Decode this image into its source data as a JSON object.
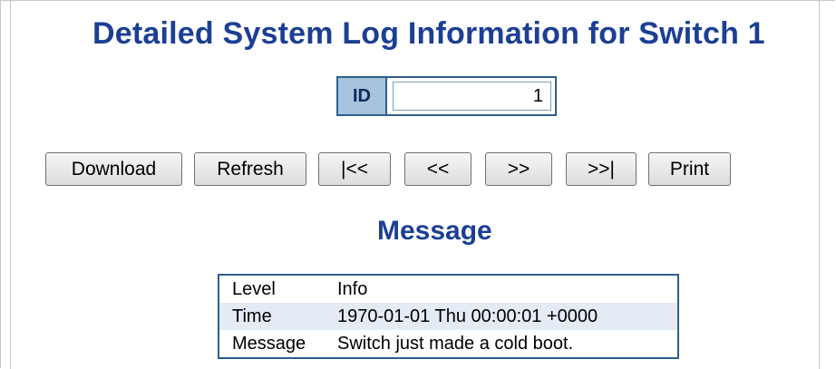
{
  "page": {
    "title": "Detailed System Log Information for Switch 1"
  },
  "id_field": {
    "label": "ID",
    "value": "1"
  },
  "toolbar": {
    "download": "Download",
    "refresh": "Refresh",
    "first": "|<<",
    "prev": "<<",
    "next": ">>",
    "last": ">>|",
    "print": "Print"
  },
  "message": {
    "heading": "Message",
    "rows": [
      {
        "key": "Level",
        "value": "Info"
      },
      {
        "key": "Time",
        "value": "1970-01-01 Thu 00:00:01 +0000"
      },
      {
        "key": "Message",
        "value": "Switch just made a cold boot."
      }
    ]
  },
  "colors": {
    "title": "#1c3f94",
    "label_bg": "#a7c3de",
    "border": "#2f5e8c",
    "alt_row": "#e4ebf5"
  }
}
